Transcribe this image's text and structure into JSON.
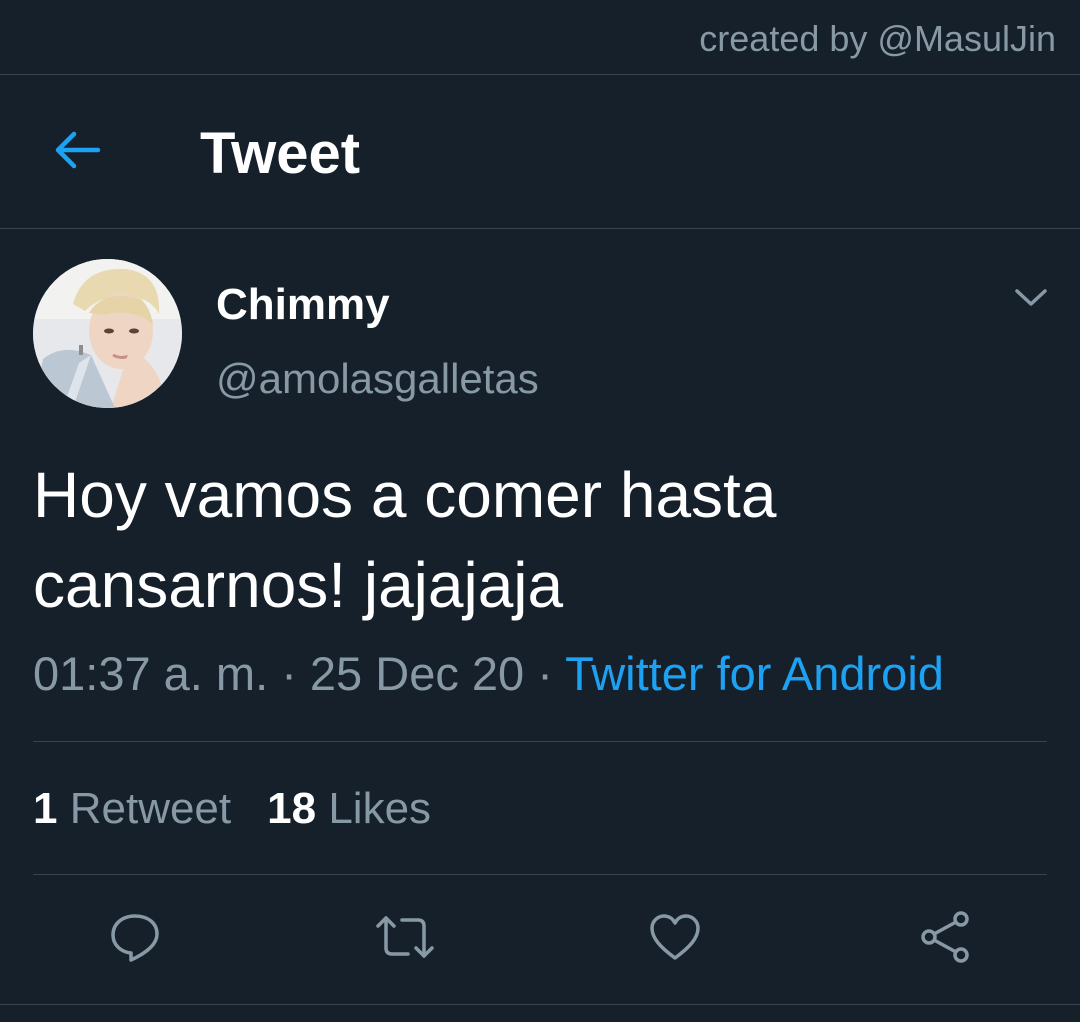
{
  "watermark": "created by @MasulJin",
  "header": {
    "title": "Tweet",
    "back_icon": "arrow-left-icon"
  },
  "tweet": {
    "author": {
      "display_name": "Chimmy",
      "handle": "@amolasgalletas",
      "avatar": "profile-photo"
    },
    "text_line1": "Hoy vamos a comer hasta",
    "text_line2": "cansarnos! jajajaja",
    "time": "01:37 a. m.",
    "separator": "·",
    "date": "25 Dec 20",
    "source": "Twitter for Android",
    "stats": {
      "retweets_count": "1",
      "retweets_label": "Retweet",
      "likes_count": "18",
      "likes_label": "Likes"
    }
  },
  "actions": [
    "reply-icon",
    "retweet-icon",
    "like-icon",
    "share-icon"
  ],
  "colors": {
    "background": "#15202b",
    "accent": "#1da1f2",
    "secondary_text": "#8899a6",
    "divider": "#38444d"
  }
}
